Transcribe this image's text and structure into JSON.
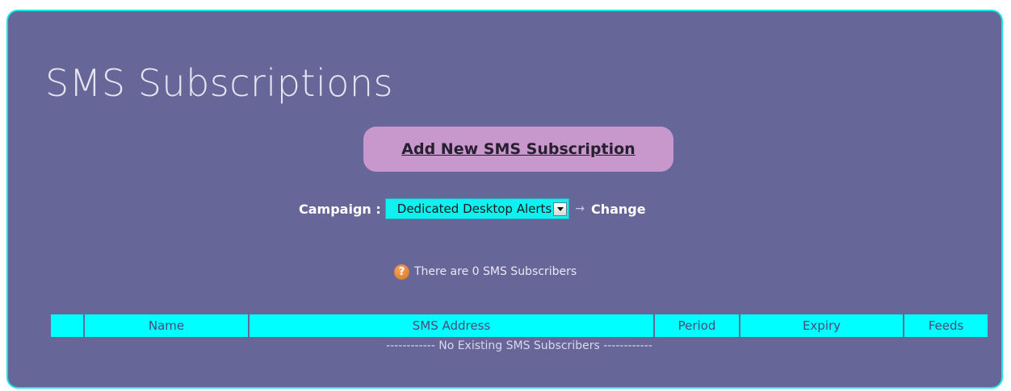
{
  "page": {
    "title": "SMS Subscriptions",
    "add_button_label": "Add New SMS Subscription"
  },
  "campaign": {
    "label": "Campaign :",
    "selected": "Dedicated Desktop Alerts",
    "arrow": "→",
    "change_label": "Change"
  },
  "info": {
    "icon": "?",
    "text": "There are 0 SMS Subscribers"
  },
  "table": {
    "headers": [
      "",
      "Name",
      "SMS Address",
      "Period",
      "Expiry",
      "Feeds"
    ],
    "empty_message": "------------ No Existing SMS Subscribers ------------"
  },
  "colors": {
    "panel_bg": "#676698",
    "panel_border": "#16e4e4",
    "add_button_bg": "#c897cb",
    "select_bg": "#0ff0f0",
    "table_header_bg": "#00ffff",
    "help_icon": "#e07a28"
  }
}
